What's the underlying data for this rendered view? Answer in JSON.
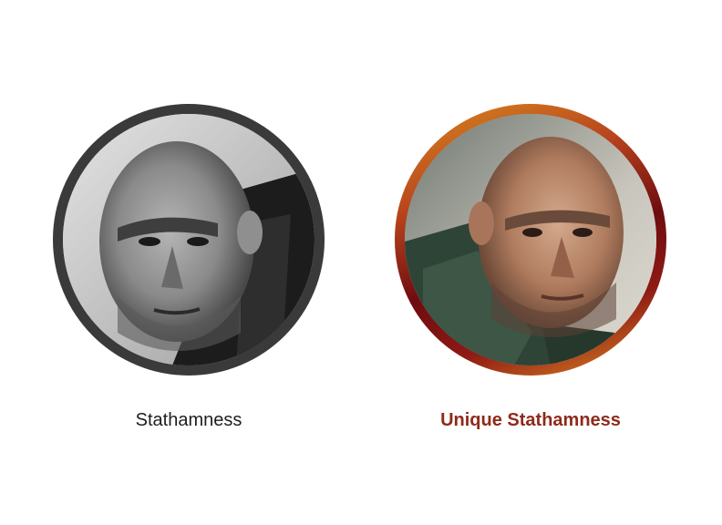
{
  "portraits": [
    {
      "style": "monochrome",
      "ring_color": "#3a3a3a",
      "caption": "Stathamness",
      "caption_color": "#1e1e1e"
    },
    {
      "style": "color",
      "ring_colors": [
        "#d98a1f",
        "#6e0c10"
      ],
      "caption": "Unique Stathamness",
      "caption_color": "#8e2a1a"
    }
  ]
}
